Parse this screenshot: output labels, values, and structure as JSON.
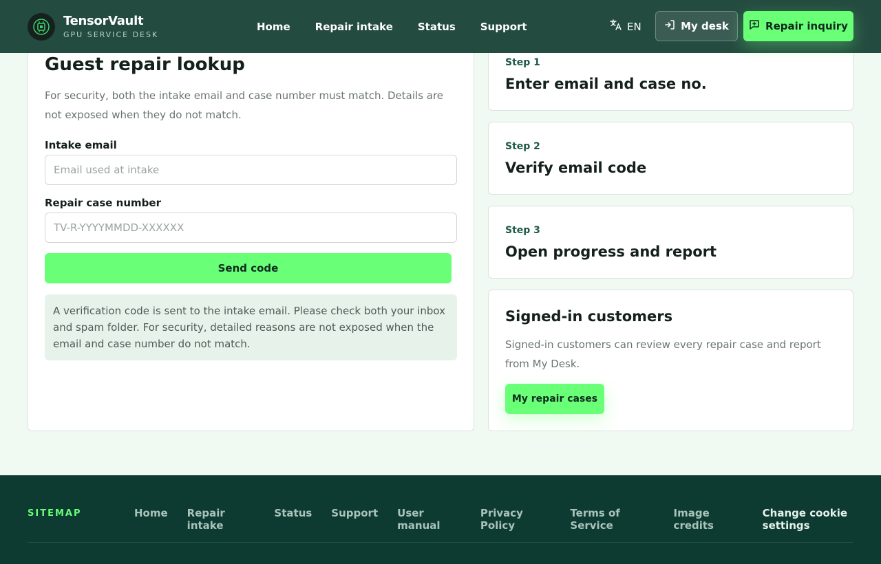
{
  "header": {
    "brand_name": "TensorVault",
    "brand_sub": "GPU SERVICE DESK",
    "nav": [
      "Home",
      "Repair intake",
      "Status",
      "Support"
    ],
    "lang": "EN",
    "desk_label": "My desk",
    "inquiry_label": "Repair inquiry"
  },
  "lookup": {
    "title": "Guest repair lookup",
    "description": "For security, both the intake email and case number must match. Details are not exposed when they do not match.",
    "email_label": "Intake email",
    "email_placeholder": "Email used at intake",
    "email_value": "",
    "case_label": "Repair case number",
    "case_placeholder": "TV-R-YYYYMMDD-XXXXXX",
    "case_value": "",
    "send_label": "Send code",
    "notice": "A verification code is sent to the intake email. Please check both your inbox and spam folder. For security, detailed reasons are not exposed when the email and case number do not match."
  },
  "steps": [
    {
      "label": "Step 1",
      "title": "Enter email and case no."
    },
    {
      "label": "Step 2",
      "title": "Verify email code"
    },
    {
      "label": "Step 3",
      "title": "Open progress and report"
    }
  ],
  "signed_in": {
    "title": "Signed-in customers",
    "description": "Signed-in customers can review every repair case and report from My Desk.",
    "button_label": "My repair cases"
  },
  "footer": {
    "sitemap_label": "SITEMAP",
    "links": [
      "Home",
      "Repair intake",
      "Status",
      "Support",
      "User manual",
      "Privacy Policy",
      "Terms of Service",
      "Image credits",
      "Change cookie settings"
    ]
  },
  "colors": {
    "header_bg": "#244b40",
    "accent": "#69ff77",
    "footer_bg": "#0d3a31",
    "page_bg": "#f1faf2"
  },
  "icons": {
    "logo": "gpu-chip-icon",
    "lang": "translate-icon",
    "desk": "sign-in-icon",
    "inquiry": "message-plus-icon"
  }
}
